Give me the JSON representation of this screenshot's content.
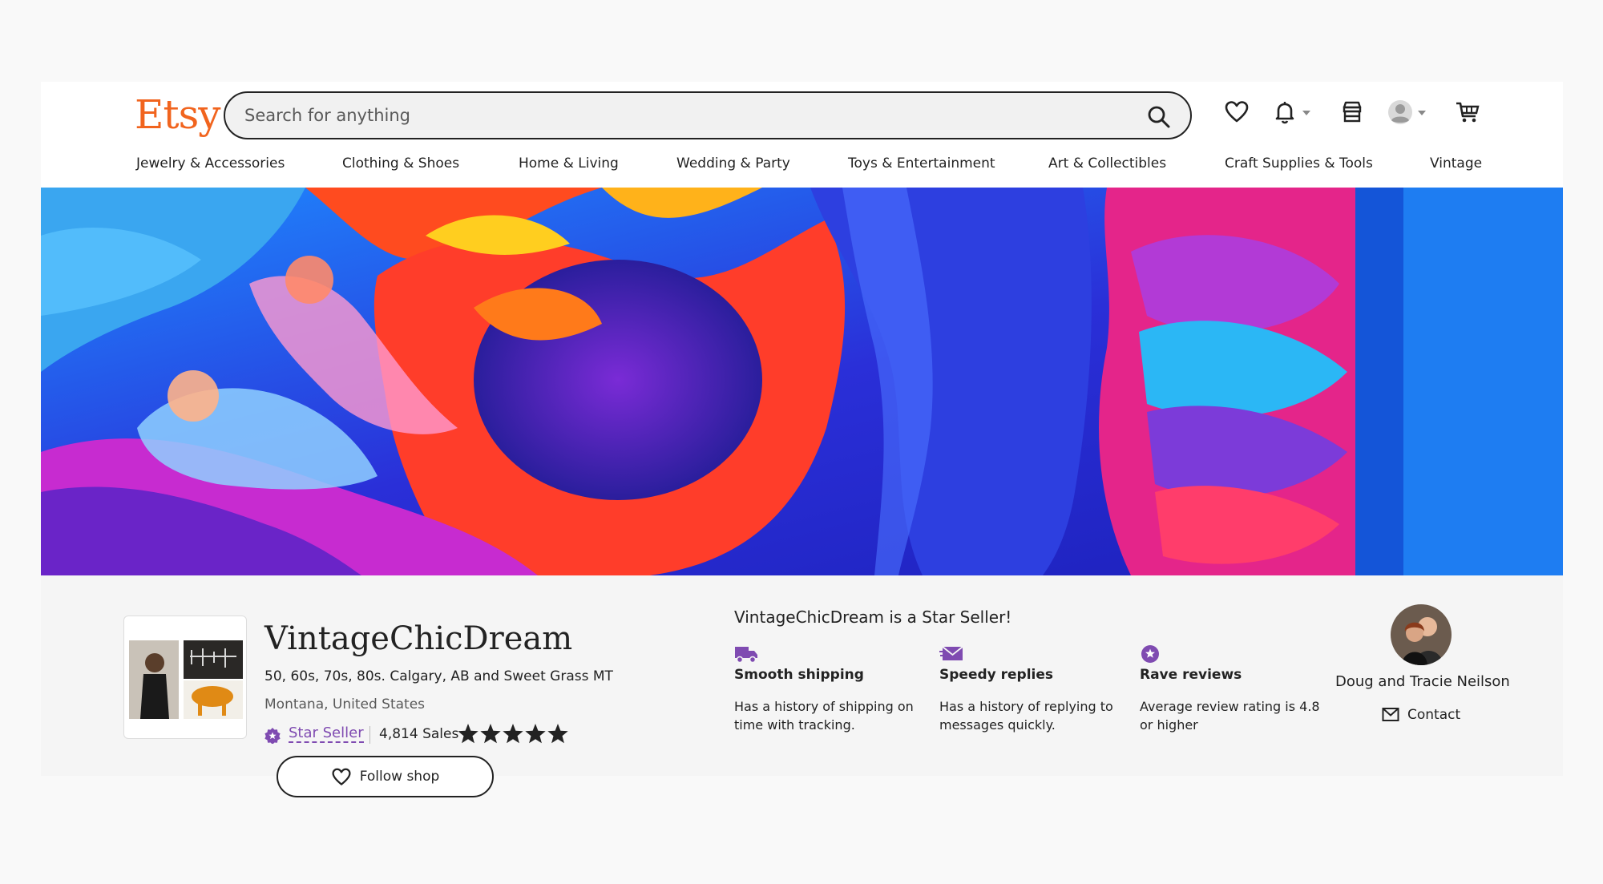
{
  "header": {
    "logo": "Etsy",
    "search_placeholder": "Search for anything"
  },
  "categories": [
    "Jewelry & Accessories",
    "Clothing & Shoes",
    "Home & Living",
    "Wedding & Party",
    "Toys & Entertainment",
    "Art & Collectibles",
    "Craft Supplies & Tools",
    "Vintage"
  ],
  "shop": {
    "name": "VintageChicDream",
    "tagline": "50, 60s, 70s, 80s. Calgary, AB and Sweet Grass MT",
    "location": "Montana, United States",
    "star_seller_label": "Star Seller",
    "sales": "4,814 Sales",
    "rating_stars": 5,
    "follow_label": "Follow shop"
  },
  "star_seller": {
    "heading": "VintageChicDream is a Star Seller!",
    "features": [
      {
        "title": "Smooth shipping",
        "desc": "Has a history of shipping on time with tracking.",
        "icon": "truck-icon"
      },
      {
        "title": "Speedy replies",
        "desc": "Has a history of replying to messages quickly.",
        "icon": "envelope-icon"
      },
      {
        "title": "Rave reviews",
        "desc": "Average review rating is 4.8 or higher",
        "icon": "star-badge-icon"
      }
    ]
  },
  "owner": {
    "name": "Doug and Tracie Neilson",
    "contact_label": "Contact"
  },
  "colors": {
    "brand": "#f1641e",
    "star_seller_purple": "#7f4bb1"
  }
}
